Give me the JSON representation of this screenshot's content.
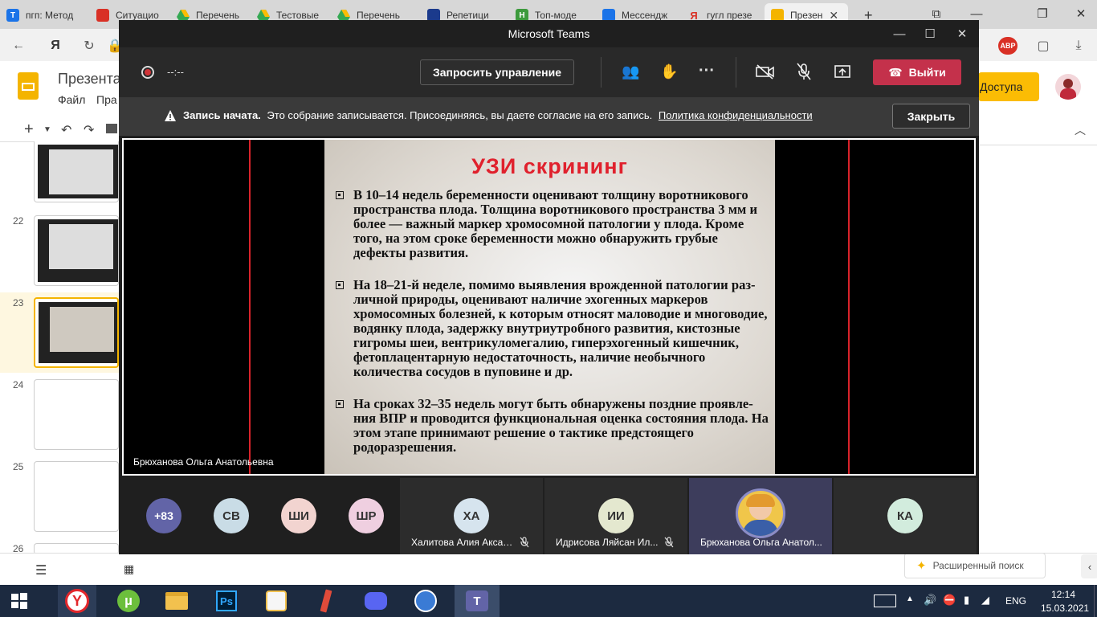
{
  "browser": {
    "tabs": [
      {
        "label": "пгп: Метод"
      },
      {
        "label": "Ситуацио"
      },
      {
        "label": "Перечень"
      },
      {
        "label": "Тестовые"
      },
      {
        "label": "Перечень"
      },
      {
        "label": "Репетици"
      },
      {
        "label": "Топ-моде"
      },
      {
        "label": "Мессендж"
      },
      {
        "label": "гугл презе"
      },
      {
        "label": "Презен"
      }
    ],
    "new_tab": "+",
    "adblock_badge": "ABP"
  },
  "slides_app": {
    "doc_title": "Презента",
    "menu": [
      "Файл",
      "Пра"
    ],
    "share_button": "Доступа",
    "thumb_numbers": [
      "22",
      "23",
      "24",
      "25",
      "26"
    ],
    "explore_button": "Расширенный поиск",
    "add_button": "+"
  },
  "teams": {
    "window_title": "Microsoft Teams",
    "rec_time": "--:--",
    "request_control": "Запросить управление",
    "leave_button": "Выйти",
    "notice_bold": "Запись начата.",
    "notice_text": "Это собрание записывается. Присоединяясь, вы даете согласие на его запись.",
    "notice_link": "Политика конфиденциальности",
    "notice_close": "Закрыть",
    "presenter_label": "Брюханова Ольга Анатольевна",
    "more_participants": "+83",
    "avatars": [
      {
        "initials": "СВ",
        "color": "#c9dce6"
      },
      {
        "initials": "ШИ",
        "color": "#f2d4d0"
      },
      {
        "initials": "ШР",
        "color": "#efcfe0"
      }
    ],
    "tiles": [
      {
        "initials": "ХА",
        "name": "Халитова Алия Аксан...",
        "color": "#d6e4ee",
        "muted": true
      },
      {
        "initials": "ИИ",
        "name": "Идрисова Ляйсан Ил...",
        "color": "#e4e8cf",
        "muted": true
      },
      {
        "initials": "",
        "name": "Брюханова Ольга Анатол...",
        "color": "#f0c64a",
        "muted": false
      },
      {
        "initials": "КА",
        "name": "",
        "color": "#d2ecdd",
        "muted": false
      }
    ]
  },
  "slide": {
    "title": "УЗИ скрининг",
    "bullets": [
      "В 10–14 недель беременности оценивают толщину воротникового пространства плода. Толщина воротникового пространства 3 мм и более — важный маркер хромосомной патологии у плода. Кроме того, на этом сроке беременности можно обнаружить грубые дефекты развития.",
      "На 18–21-й неделе, помимо выявления врожденной патологии раз- личной природы, оценивают наличие эхогенных маркеров хромосомных болезней, к которым относят маловодие и многоводие, водянку плода, задержку внутриутробного развития, кистозные гигромы шеи, вентрикуломегалию, гиперэхогенный кишечник, фетоплацентарную недостаточность, наличие необычного количества сосудов в пуповине и др.",
      "На сроках 32–35 недель могут быть обнаружены поздние проявле- ния ВПР и проводится функциональная оценка состояния плода. На этом этапе принимают решение о тактике предстоящего родоразрешения."
    ]
  },
  "taskbar": {
    "lang": "ENG",
    "time": "12:14",
    "date": "15.03.2021"
  },
  "colors": {
    "teams_bg": "#1f1f1f",
    "leave_red": "#c4314b",
    "slide_title_red": "#e0212d",
    "taskbar_bg": "#1c2a40",
    "share_yellow": "#fbbc04"
  }
}
